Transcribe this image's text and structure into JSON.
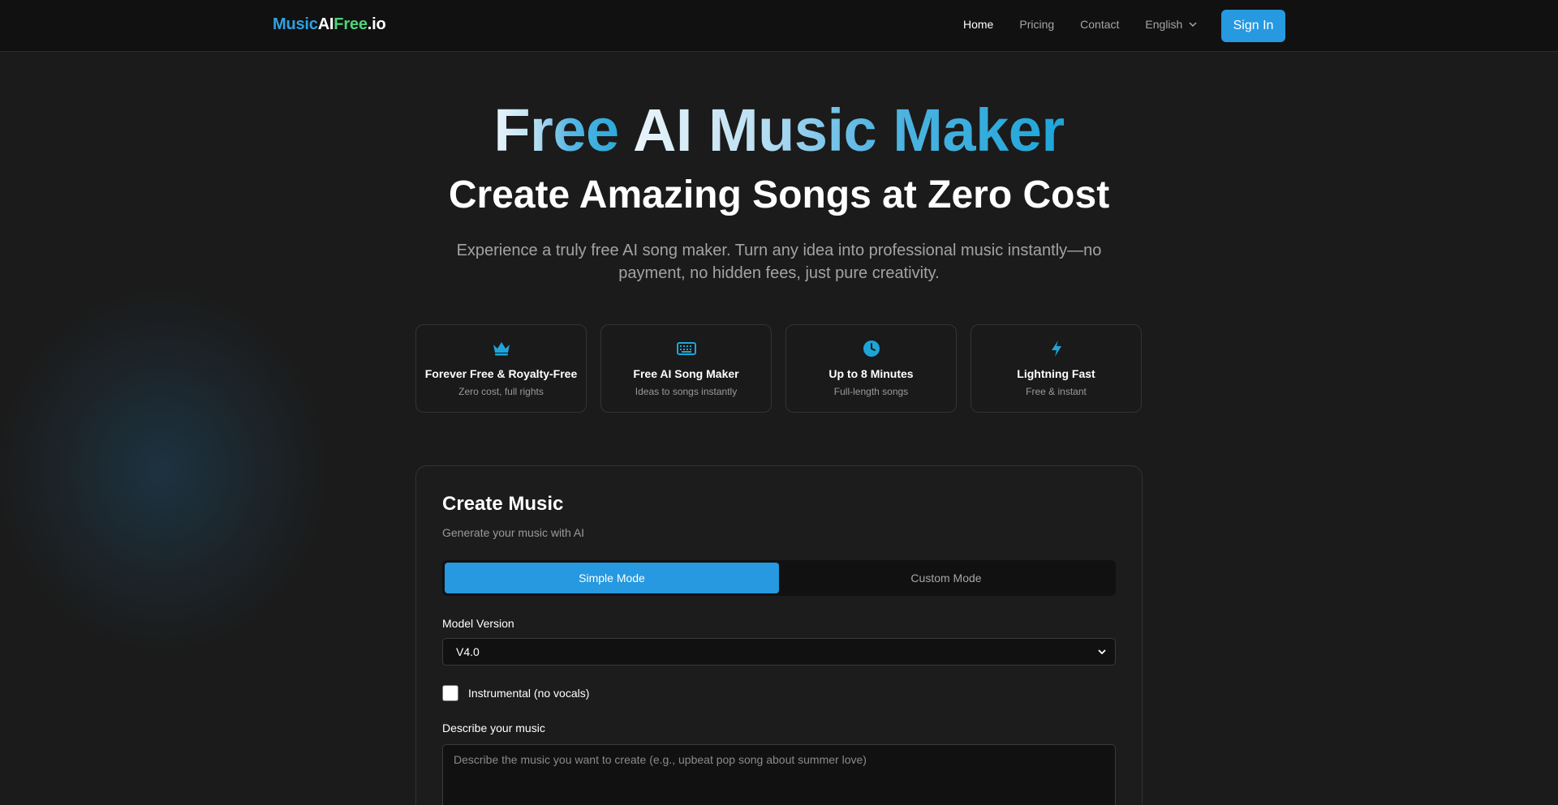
{
  "nav": {
    "logo": {
      "part1": "Music",
      "part2": "AI",
      "part3": "Free",
      "part4": ".io"
    },
    "links": [
      "Home",
      "Pricing",
      "Contact"
    ],
    "language": "English",
    "signin": "Sign In"
  },
  "hero": {
    "title_part1": "Free ",
    "title_part2": "AI Music Maker",
    "subtitle": "Create Amazing Songs at Zero Cost",
    "description": "Experience a truly free AI song maker. Turn any idea into professional music instantly—no payment, no hidden fees, just pure creativity."
  },
  "features": [
    {
      "icon": "crown-icon",
      "title": "Forever Free & Royalty-Free",
      "subtitle": "Zero cost, full rights"
    },
    {
      "icon": "keyboard-icon",
      "title": "Free AI Song Maker",
      "subtitle": "Ideas to songs instantly"
    },
    {
      "icon": "clock-icon",
      "title": "Up to 8 Minutes",
      "subtitle": "Full-length songs"
    },
    {
      "icon": "lightning-icon",
      "title": "Lightning Fast",
      "subtitle": "Free & instant"
    }
  ],
  "create": {
    "title": "Create Music",
    "subtitle": "Generate your music with AI",
    "modes": [
      "Simple Mode",
      "Custom Mode"
    ],
    "active_mode": "Simple Mode",
    "model_label": "Model Version",
    "model_value": "V4.0",
    "instrumental_label": "Instrumental (no vocals)",
    "instrumental_checked": false,
    "describe_label": "Describe your music",
    "describe_placeholder": "Describe the music you want to create (e.g., upbeat pop song about summer love)"
  },
  "colors": {
    "accent": "#2699e0",
    "icon": "#1ea5d8",
    "logo_green": "#4fd37a"
  }
}
